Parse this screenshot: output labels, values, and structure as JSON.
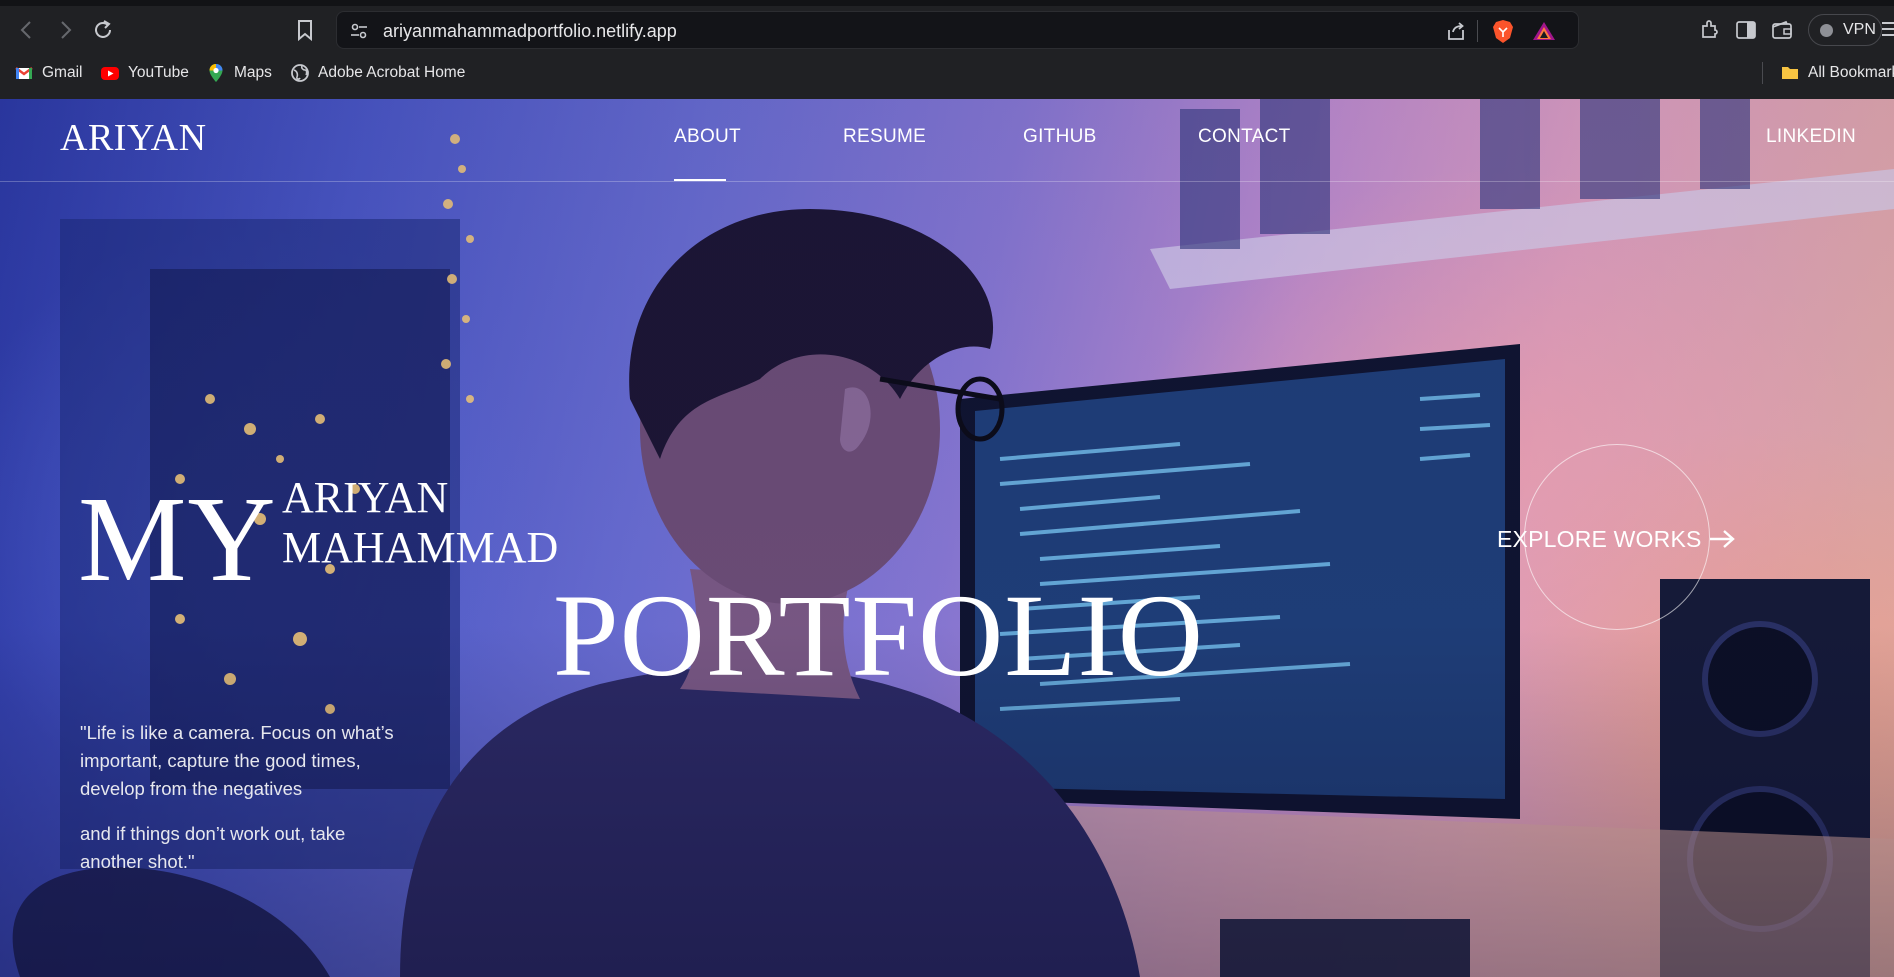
{
  "browser": {
    "url": "ariyanmahammadportfolio.netlify.app",
    "vpn_label": "VPN",
    "bookmarks": [
      {
        "label": "Gmail",
        "icon": "gmail-icon"
      },
      {
        "label": "YouTube",
        "icon": "youtube-icon"
      },
      {
        "label": "Maps",
        "icon": "maps-icon"
      },
      {
        "label": "Adobe Acrobat Home",
        "icon": "globe-icon"
      }
    ],
    "all_bookmarks_label": "All Bookmark"
  },
  "site": {
    "logo": "ARIYAN",
    "nav": [
      {
        "label": "ABOUT",
        "active": true
      },
      {
        "label": "RESUME",
        "active": false
      },
      {
        "label": "GITHUB",
        "active": false
      },
      {
        "label": "CONTACT",
        "active": false
      }
    ],
    "linkedin_label": "LINKEDIN"
  },
  "hero": {
    "title_my": "MY",
    "title_name_line1": "ARIYAN",
    "title_name_line2": "MAHAMMAD",
    "title_portfolio": "PORTFOLIO",
    "quote_part1": "\"Life is like a camera. Focus on what’s important, capture the good times, develop from the negatives",
    "quote_part2": "and if things don’t work out, take another shot.\"",
    "explore_label": "EXPLORE WORKS"
  },
  "colors": {
    "chrome_bg": "#202124",
    "urlbar_bg": "#131418",
    "text_light": "#e6e6e8",
    "hero_text": "#ffffff",
    "brave_orange": "#fb542b"
  }
}
